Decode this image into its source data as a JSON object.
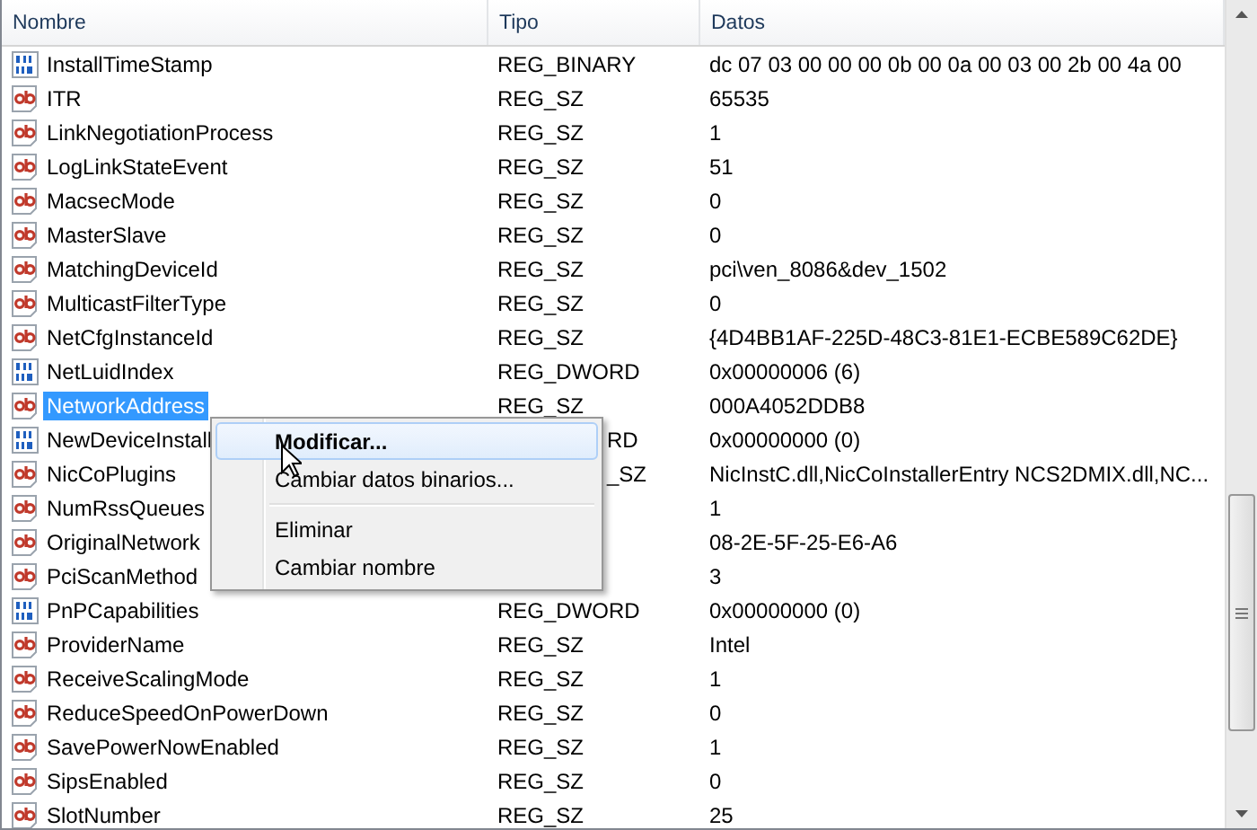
{
  "columns": [
    "Nombre",
    "Tipo",
    "Datos"
  ],
  "rows": [
    {
      "kind": "bin",
      "name": "InstallTimeStamp",
      "type": "REG_BINARY",
      "data": "dc 07 03 00 00 00 0b 00 0a 00 03 00 2b 00 4a 00",
      "selected": false
    },
    {
      "kind": "sz",
      "name": "ITR",
      "type": "REG_SZ",
      "data": "65535",
      "selected": false
    },
    {
      "kind": "sz",
      "name": "LinkNegotiationProcess",
      "type": "REG_SZ",
      "data": "1",
      "selected": false
    },
    {
      "kind": "sz",
      "name": "LogLinkStateEvent",
      "type": "REG_SZ",
      "data": "51",
      "selected": false
    },
    {
      "kind": "sz",
      "name": "MacsecMode",
      "type": "REG_SZ",
      "data": "0",
      "selected": false
    },
    {
      "kind": "sz",
      "name": "MasterSlave",
      "type": "REG_SZ",
      "data": "0",
      "selected": false
    },
    {
      "kind": "sz",
      "name": "MatchingDeviceId",
      "type": "REG_SZ",
      "data": "pci\\ven_8086&dev_1502",
      "selected": false
    },
    {
      "kind": "sz",
      "name": "MulticastFilterType",
      "type": "REG_SZ",
      "data": "0",
      "selected": false
    },
    {
      "kind": "sz",
      "name": "NetCfgInstanceId",
      "type": "REG_SZ",
      "data": "{4D4BB1AF-225D-48C3-81E1-ECBE589C62DE}",
      "selected": false
    },
    {
      "kind": "bin",
      "name": "NetLuidIndex",
      "type": "REG_DWORD",
      "data": "0x00000006 (6)",
      "selected": false
    },
    {
      "kind": "sz",
      "name": "NetworkAddress",
      "type": "REG_SZ",
      "data": "000A4052DDB8",
      "selected": true
    },
    {
      "kind": "bin",
      "name": "NewDeviceInstall",
      "type": "RD",
      "type_cut": true,
      "data": "0x00000000 (0)",
      "selected": false
    },
    {
      "kind": "sz",
      "name": "NicCoPlugins",
      "type": "_SZ",
      "type_cut": true,
      "data": "NicInstC.dll,NicCoInstallerEntry NCS2DMIX.dll,NC...",
      "selected": false
    },
    {
      "kind": "sz",
      "name": "NumRssQueues",
      "data": "1",
      "selected": false
    },
    {
      "kind": "sz",
      "name": "OriginalNetwork",
      "data": "08-2E-5F-25-E6-A6",
      "selected": false
    },
    {
      "kind": "sz",
      "name": "PciScanMethod",
      "data": "3",
      "selected": false
    },
    {
      "kind": "bin",
      "name": "PnPCapabilities",
      "type": "REG_DWORD",
      "data": "0x00000000 (0)",
      "selected": false
    },
    {
      "kind": "sz",
      "name": "ProviderName",
      "type": "REG_SZ",
      "data": "Intel",
      "selected": false
    },
    {
      "kind": "sz",
      "name": "ReceiveScalingMode",
      "type": "REG_SZ",
      "data": "1",
      "selected": false
    },
    {
      "kind": "sz",
      "name": "ReduceSpeedOnPowerDown",
      "type": "REG_SZ",
      "data": "0",
      "selected": false
    },
    {
      "kind": "sz",
      "name": "SavePowerNowEnabled",
      "type": "REG_SZ",
      "data": "1",
      "selected": false
    },
    {
      "kind": "sz",
      "name": "SipsEnabled",
      "type": "REG_SZ",
      "data": "0",
      "selected": false
    },
    {
      "kind": "sz",
      "name": "SlotNumber",
      "type": "REG_SZ",
      "data": "25",
      "selected": false
    }
  ],
  "context_menu": [
    {
      "kind": "item",
      "label": "Modificar...",
      "default": true,
      "hovered": true
    },
    {
      "kind": "item",
      "label": "Cambiar datos binarios...",
      "default": false,
      "hovered": false
    },
    {
      "kind": "separator"
    },
    {
      "kind": "item",
      "label": "Eliminar",
      "default": false,
      "hovered": false
    },
    {
      "kind": "item",
      "label": "Cambiar nombre",
      "default": false,
      "hovered": false
    }
  ]
}
